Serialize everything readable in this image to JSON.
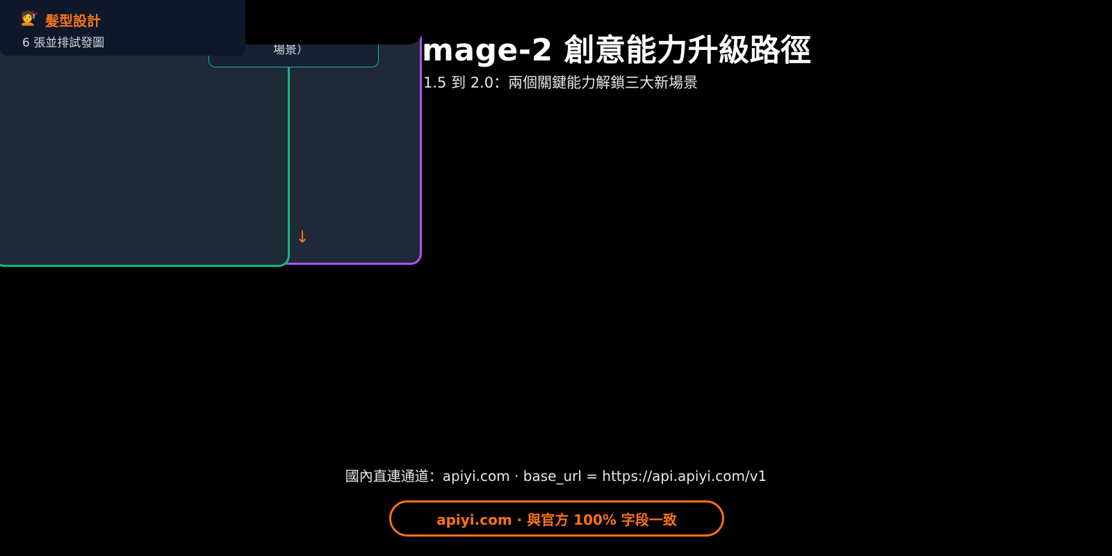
{
  "header": {
    "title": "mage-2 創意能力升級路徑",
    "subtitle": "1.5 到 2.0：兩個關鍵能力解鎖三大新場景"
  },
  "diagram": {
    "partial_card_text": "場景）",
    "feature_card": {
      "icon": "💇",
      "title": "髮型設計",
      "subtitle": "6 張並排試發圖"
    },
    "arrow": "↓"
  },
  "footer": {
    "channel_text": "國內直連通道：apiyi.com · base_url = https://api.apiyi.com/v1",
    "cta_label": "apiyi.com · 與官方 100% 字段一致"
  },
  "colors": {
    "background": "#000000",
    "accent_orange": "#f97316",
    "purple_border": "#a855f7",
    "green_border": "#10b981",
    "teal_border": "#14b8a6",
    "panel_bg": "#1f2937"
  }
}
